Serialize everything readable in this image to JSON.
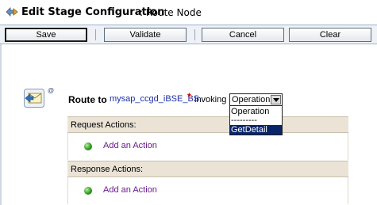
{
  "header": {
    "title": "Edit Stage Configuration",
    "subtitle": ": Route Node",
    "icon": "stage-config-icon"
  },
  "toolbar": {
    "save_label": "Save",
    "validate_label": "Validate",
    "cancel_label": "Cancel",
    "clear_label": "Clear"
  },
  "route": {
    "icon": "route-envelope-icon",
    "at_mark": "@",
    "route_to_label": "Route to",
    "target": "mysap_ccgd_iBSE_BS",
    "required_mark": "*",
    "invoking_label": "invoking",
    "operation_select": {
      "selected": "Operation",
      "options": [
        "Operation",
        "---------",
        "GetDetail"
      ],
      "highlighted": "GetDetail"
    }
  },
  "request_actions": {
    "label": "Request Actions:",
    "add_action": "Add an Action"
  },
  "response_actions": {
    "label": "Response Actions:",
    "add_action": "Add an Action"
  },
  "colors": {
    "section_header": "#ebe4d6",
    "link": "#1c2fa5",
    "add_action_link": "#6a1a8c",
    "required": "#cc0000",
    "selected_option": "#0a246a"
  }
}
